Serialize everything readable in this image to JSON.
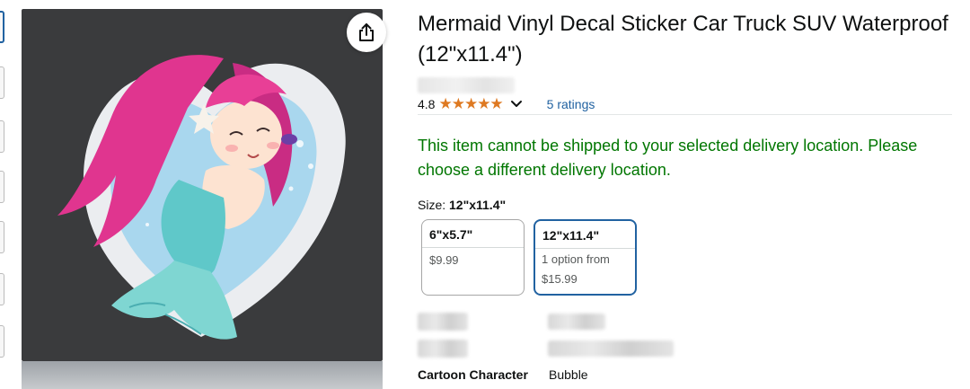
{
  "product": {
    "title": "Mermaid Vinyl Decal Sticker Car Truck SUV Waterproof (12\"x11.4\")",
    "rating_value": "4.8",
    "stars_text": "★★★★★",
    "rating_count": "5 ratings",
    "availability_message": "This item cannot be shipped to your selected delivery location. Please choose a different delivery location."
  },
  "size_selector": {
    "label_prefix": "Size:",
    "selected_value": "12\"x11.4\"",
    "options": [
      {
        "name": "6\"x5.7\"",
        "price": "$9.99",
        "selected": false
      },
      {
        "name": "12\"x11.4\"",
        "line1": "1 option from",
        "line2": "$15.99",
        "selected": true
      }
    ]
  },
  "specs": [
    {
      "key": "Cartoon Character",
      "value": "Bubble"
    }
  ],
  "icons": {
    "share": "share-icon",
    "chevron": "chevron-down-icon",
    "stars": "star-icon"
  },
  "colors": {
    "link": "#2162a1",
    "availability": "#007600",
    "star": "#de7921",
    "image_bg": "#3a3b3d",
    "selected_border": "#2162a1"
  }
}
